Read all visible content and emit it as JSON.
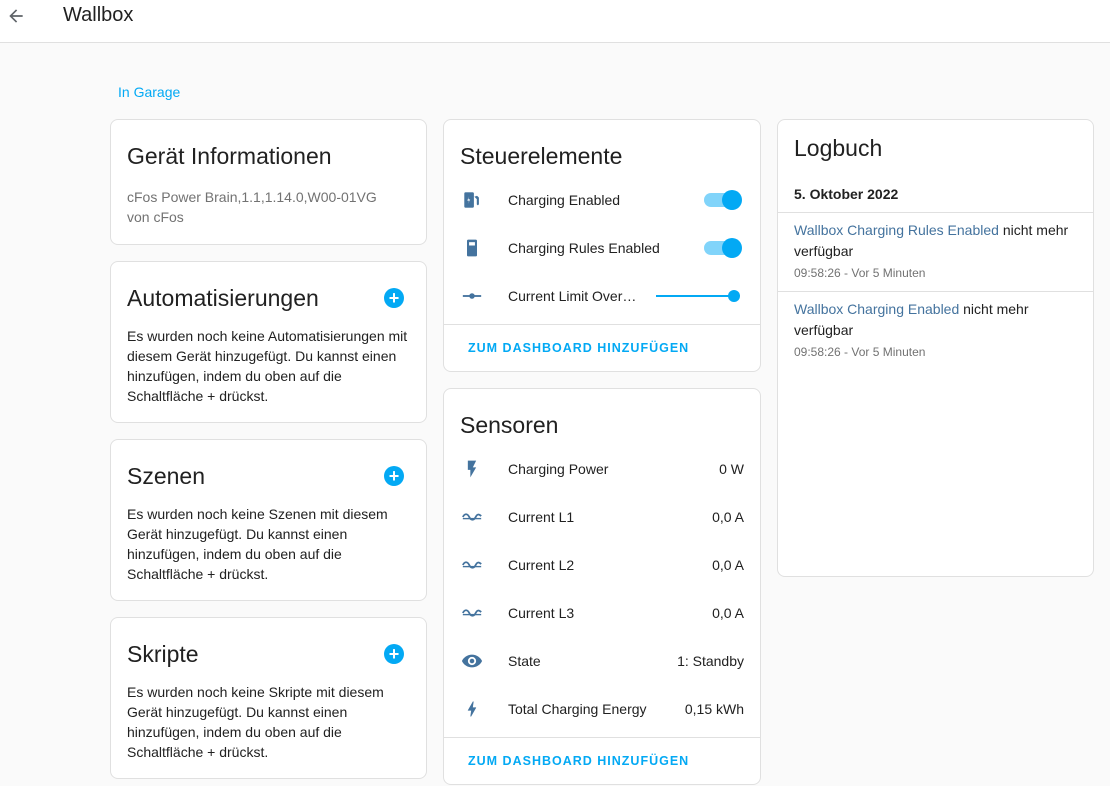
{
  "header": {
    "title": "Wallbox"
  },
  "area_link": "In Garage",
  "device_info": {
    "title": "Gerät Informationen",
    "model": "cFos Power Brain,1.1,1.14.0,W00-01VG",
    "manufacturer": "von cFos"
  },
  "automations": {
    "title": "Automatisierungen",
    "text": "Es wurden noch keine Automatisierungen mit diesem Gerät hinzugefügt. Du kannst einen hinzufügen, indem du oben auf die Schaltfläche + drückst.",
    "add": "+"
  },
  "scenes": {
    "title": "Szenen",
    "text": "Es wurden noch keine Szenen mit diesem Gerät hinzugefügt. Du kannst einen hinzufügen, indem du oben auf die Schaltfläche + drückst.",
    "add": "+"
  },
  "scripts": {
    "title": "Skripte",
    "text": "Es wurden noch keine Skripte mit diesem Gerät hinzugefügt. Du kannst einen hinzufügen, indem du oben auf die Schaltfläche + drückst.",
    "add": "+"
  },
  "controls": {
    "title": "Steuerelemente",
    "items": [
      {
        "label": "Charging Enabled",
        "icon": "ev-station-icon",
        "state": "on"
      },
      {
        "label": "Charging Rules Enabled",
        "icon": "battery-icon",
        "state": "on"
      },
      {
        "label": "Current Limit Over…",
        "icon": "slider-icon",
        "level": 1.0
      }
    ],
    "dashboard_button": "ZUM DASHBOARD HINZUFÜGEN"
  },
  "sensors": {
    "title": "Sensoren",
    "items": [
      {
        "label": "Charging Power",
        "value": "0 W",
        "icon": "flash-icon"
      },
      {
        "label": "Current L1",
        "value": "0,0 A",
        "icon": "sine-wave-icon"
      },
      {
        "label": "Current L2",
        "value": "0,0 A",
        "icon": "sine-wave-icon"
      },
      {
        "label": "Current L3",
        "value": "0,0 A",
        "icon": "sine-wave-icon"
      },
      {
        "label": "State",
        "value": "1: Standby",
        "icon": "eye-icon"
      },
      {
        "label": "Total Charging Energy",
        "value": "0,15 kWh",
        "icon": "lightning-icon"
      }
    ],
    "dashboard_button": "ZUM DASHBOARD HINZUFÜGEN"
  },
  "logbook": {
    "title": "Logbuch",
    "date": "5. Oktober 2022",
    "entries": [
      {
        "entity": "Wallbox Charging Rules Enabled",
        "message": " nicht mehr verfügbar",
        "time": "09:58:26 - Vor 5 Minuten"
      },
      {
        "entity": "Wallbox Charging Enabled",
        "message": " nicht mehr verfügbar",
        "time": "09:58:26 - Vor 5 Minuten"
      }
    ]
  },
  "colors": {
    "accent": "#03a9f4",
    "icon": "#44739e",
    "entity_link": "#44739e"
  }
}
